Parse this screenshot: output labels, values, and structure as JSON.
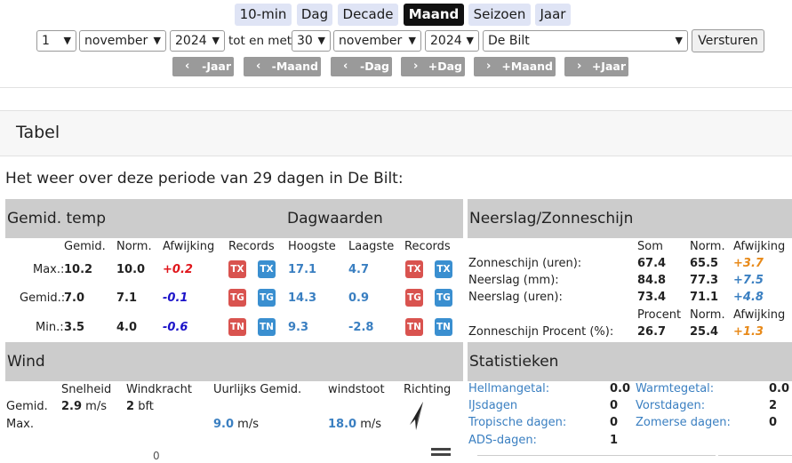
{
  "tabs": [
    {
      "label": "10-min",
      "active": false
    },
    {
      "label": "Dag",
      "active": false
    },
    {
      "label": "Decade",
      "active": false
    },
    {
      "label": "Maand",
      "active": true
    },
    {
      "label": "Seizoen",
      "active": false
    },
    {
      "label": "Jaar",
      "active": false
    }
  ],
  "form": {
    "from_day": "1",
    "from_month": "november",
    "from_year": "2024",
    "between": "tot en met",
    "to_day": "30",
    "to_month": "november",
    "to_year": "2024",
    "station": "De Bilt",
    "submit": "Versturen"
  },
  "nav": [
    "-Jaar",
    "-Maand",
    "-Dag",
    "+Dag",
    "+Maand",
    "+Jaar"
  ],
  "section_title": "Tabel",
  "summary": "Het weer over deze periode van 29 dagen in De Bilt:",
  "temp": {
    "header": "Gemid. temp",
    "dag_header": "Dagwaarden",
    "cols": {
      "gemid": "Gemid.",
      "norm": "Norm.",
      "afw": "Afwijking",
      "records": "Records",
      "hoogste": "Hoogste",
      "laagste": "Laagste",
      "records2": "Records"
    },
    "rows": [
      {
        "label": "Max.:",
        "gemid": "10.2",
        "norm": "10.0",
        "afw": "+0.2",
        "rec1": "TX",
        "rec2": "TX",
        "hoogste": "17.1",
        "laagste": "4.7",
        "rec3": "TX",
        "rec4": "TX"
      },
      {
        "label": "Gemid.:",
        "gemid": "7.0",
        "norm": "7.1",
        "afw": "-0.1",
        "rec1": "TG",
        "rec2": "TG",
        "hoogste": "14.3",
        "laagste": "0.9",
        "rec3": "TG",
        "rec4": "TG"
      },
      {
        "label": "Min.:",
        "gemid": "3.5",
        "norm": "4.0",
        "afw": "-0.6",
        "rec1": "TN",
        "rec2": "TN",
        "hoogste": "9.3",
        "laagste": "-2.8",
        "rec3": "TN",
        "rec4": "TN"
      }
    ]
  },
  "neerslag": {
    "header": "Neerslag/Zonneschijn",
    "cols": {
      "som": "Som",
      "norm": "Norm.",
      "afw": "Afwijking"
    },
    "rows": [
      {
        "label": "Zonneschijn (uren):",
        "som": "67.4",
        "norm": "65.5",
        "afw": "+3.7"
      },
      {
        "label": "Neerslag (mm):",
        "som": "84.8",
        "norm": "77.3",
        "afw": "+7.5"
      },
      {
        "label": "Neerslag (uren):",
        "som": "73.4",
        "norm": "71.1",
        "afw": "+4.8"
      }
    ],
    "pct_cols": {
      "pct": "Procent",
      "norm": "Norm.",
      "afw": "Afwijking"
    },
    "pct_row": {
      "label": "Zonneschijn Procent (%):",
      "pct": "26.7",
      "norm": "25.4",
      "afw": "+1.3"
    }
  },
  "wind": {
    "header": "Wind",
    "cols": {
      "snelheid": "Snelheid",
      "windkracht": "Windkracht",
      "uurlijks": "Uurlijks Gemid.",
      "stoot": "windstoot",
      "richting": "Richting"
    },
    "gemid": {
      "label": "Gemid.",
      "snelheid": "2.9",
      "snelheid_unit": "m/s",
      "kracht": "2",
      "kracht_unit": "bft"
    },
    "max": {
      "label": "Max.",
      "uurlijks": "9.0",
      "uurlijks_unit": "m/s",
      "stoot": "18.0",
      "stoot_unit": "m/s"
    },
    "bottom_text": "0"
  },
  "stats": {
    "header": "Statistieken",
    "left": [
      {
        "label": "Hellmangetal:",
        "value": "0.0"
      },
      {
        "label": "IJsdagen",
        "value": "0"
      },
      {
        "label": "Tropische dagen:",
        "value": "0"
      },
      {
        "label": "ADS-dagen:",
        "value": "1"
      }
    ],
    "right": [
      {
        "label": "Warmtegetal:",
        "value": "0.0"
      },
      {
        "label": "Vorstdagen:",
        "value": "2"
      },
      {
        "label": "Zomerse dagen:",
        "value": "0"
      }
    ]
  },
  "colors": {
    "positive": "#e0151b",
    "negative": "#1b12c9",
    "orange": "#e88a1a",
    "blue": "#3a7fc1",
    "record_red": "#d9534f",
    "record_blue": "#3a8fd0"
  }
}
